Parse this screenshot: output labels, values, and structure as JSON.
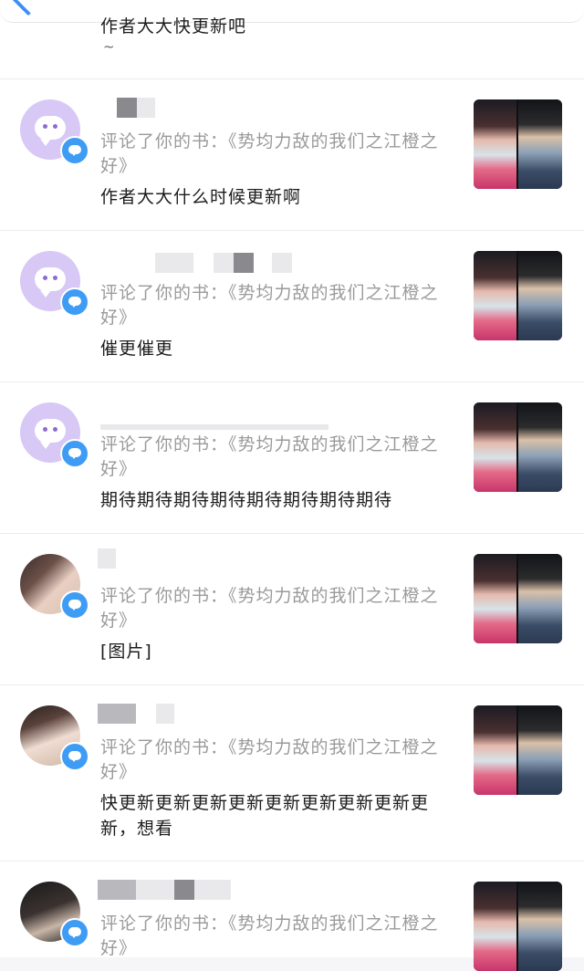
{
  "header": {
    "partial_comment": "作者大大快更新吧",
    "partial_tilde": "~"
  },
  "notifications": [
    {
      "avatar": "bot-icon",
      "action": "评论了你的书：《势均力敌的我们之江橙之好》",
      "content": "作者大大什么时候更新啊"
    },
    {
      "avatar": "bot-icon",
      "action": "评论了你的书：《势均力敌的我们之江橙之好》",
      "content": "催更催更"
    },
    {
      "avatar": "bot-icon",
      "action": "评论了你的书：《势均力敌的我们之江橙之好》",
      "content": "期待期待期待期待期待期待期待期待"
    },
    {
      "avatar": "user-photo",
      "action": "评论了你的书：《势均力敌的我们之江橙之好》",
      "content": "[图片]"
    },
    {
      "avatar": "user-photo",
      "action": "评论了你的书：《势均力敌的我们之江橙之好》",
      "content": "快更新更新更新更新更新更新更新更新更新，想看"
    },
    {
      "avatar": "user-photo",
      "action": "评论了你的书：《势均力敌的我们之江橙之好》",
      "content": ""
    }
  ],
  "colors": {
    "badge": "#3f9cf5",
    "bot_avatar_bg": "#d7c8f5",
    "secondary_text": "#9a9a9a",
    "primary_text": "#1c1c1c"
  }
}
